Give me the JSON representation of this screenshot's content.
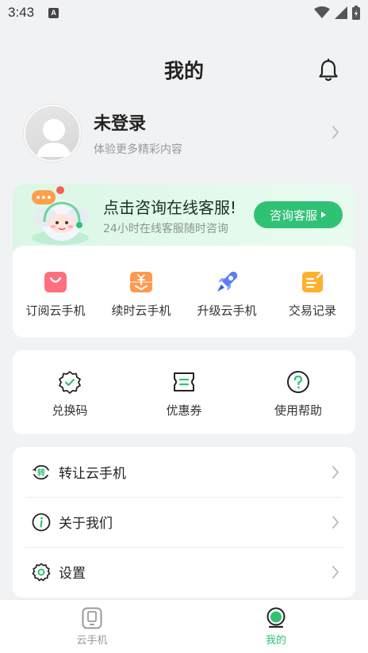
{
  "status_bar": {
    "time": "3:43",
    "notification": "A"
  },
  "header": {
    "title": "我的"
  },
  "profile": {
    "name": "未登录",
    "subtitle": "体验更多精彩内容"
  },
  "service_banner": {
    "title": "点击咨询在线客服!",
    "subtitle": "24小时在线客服随时咨询",
    "button": "咨询客服"
  },
  "service_grid": [
    {
      "label": "订阅云手机",
      "icon": "shopping-bag-icon"
    },
    {
      "label": "续时云手机",
      "icon": "renew-icon"
    },
    {
      "label": "升级云手机",
      "icon": "rocket-icon"
    },
    {
      "label": "交易记录",
      "icon": "record-icon"
    }
  ],
  "tools": [
    {
      "label": "兑换码",
      "icon": "redeem-badge-icon"
    },
    {
      "label": "优惠券",
      "icon": "coupon-icon"
    },
    {
      "label": "使用帮助",
      "icon": "help-icon"
    }
  ],
  "menu": [
    {
      "label": "转让云手机",
      "icon": "transfer-icon",
      "icon_text": "转"
    },
    {
      "label": "关于我们",
      "icon": "info-icon"
    },
    {
      "label": "设置",
      "icon": "settings-icon"
    }
  ],
  "bottom_nav": [
    {
      "label": "云手机",
      "icon": "phone-icon",
      "active": false
    },
    {
      "label": "我的",
      "icon": "profile-icon",
      "active": true
    }
  ],
  "colors": {
    "accent": "#2fc275",
    "nav_inactive": "#9a9a9a",
    "nav_active": "#2fc275",
    "background": "#f1f2f4"
  }
}
